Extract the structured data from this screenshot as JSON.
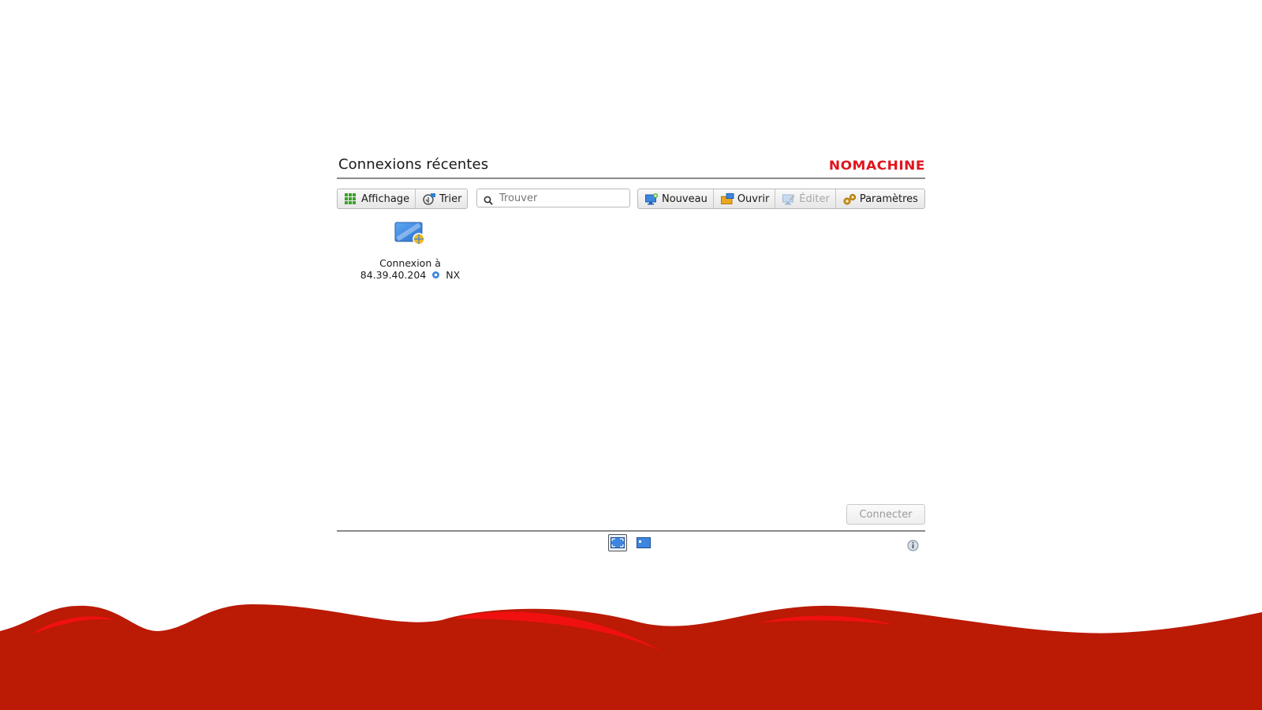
{
  "header": {
    "title": "Connexions récentes",
    "logo": "NOMACHINE"
  },
  "toolbar": {
    "view_label": "Affichage",
    "sort_label": "Trier",
    "new_label": "Nouveau",
    "open_label": "Ouvrir",
    "edit_label": "Éditer",
    "settings_label": "Paramètres"
  },
  "search": {
    "placeholder": "Trouver",
    "value": ""
  },
  "connections": [
    {
      "line1": "Connexion à",
      "host": "84.39.40.204",
      "protocol": "NX",
      "icon": "monitor-globe-icon"
    }
  ],
  "footer": {
    "connect_label": "Connecter"
  },
  "colors": {
    "brand": "#e0141e",
    "wave": "#bb1a05",
    "wave_highlight": "#f01010"
  }
}
